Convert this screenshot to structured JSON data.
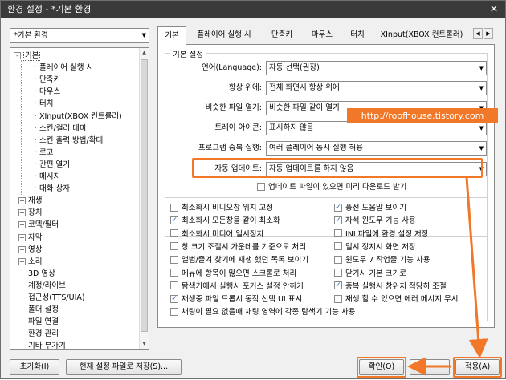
{
  "window": {
    "title": "환경 설정 - *기본 환경",
    "close": "×"
  },
  "profile": {
    "value": "*기본 환경"
  },
  "tree": {
    "root": "기본",
    "children": [
      "플레이어 실행 시",
      "단축키",
      "마우스",
      "터치",
      "XInput(XBOX 컨트롤러)",
      "스킨/컬러 테마",
      "스킨 출력 방법/확대",
      "로고",
      "간편 열기",
      "메시지",
      "대화 상자"
    ],
    "groups": [
      "재생",
      "장치",
      "코덱/필터",
      "자막",
      "영상",
      "소리"
    ],
    "items2": [
      "3D 영상",
      "계정/라이브",
      "접근성(TTS/UIA)",
      "폴더 설정",
      "파일 연결",
      "환경 관리",
      "기타 부가기"
    ]
  },
  "tabs": [
    "기본",
    "플레이어 실행 시",
    "단축키",
    "마우스",
    "터치",
    "XInput(XBOX 컨트롤러)"
  ],
  "basic_settings": {
    "group_title": "기본 설정",
    "rows": [
      {
        "label": "언어(Language):",
        "value": "자동 선택(권장)"
      },
      {
        "label": "항상 위에:",
        "value": "전체 화면시 항상 위에"
      },
      {
        "label": "비슷한 파일 열기:",
        "value": "비슷한 파일 같이 열기"
      },
      {
        "label": "트레이 아이콘:",
        "value": "표시하지 않음"
      },
      {
        "label": "프로그램 중복 실행:",
        "value": "여러 플레이어 동시 실행 허용"
      },
      {
        "label": "자동 업데이트:",
        "value": "자동 업데이트를 하지 않음"
      }
    ],
    "update_check": "업데이트 파일이 있으면 미리 다운로드 받기"
  },
  "checks_left": [
    {
      "label": "최소화시 비디오창 위치 고정",
      "checked": false
    },
    {
      "label": "최소화시 모든창을 같이 최소화",
      "checked": true
    },
    {
      "label": "최소화시 미디어 일시정지",
      "checked": false
    },
    {
      "label": "창 크기 조절시 가운데를 기준으로 처리",
      "checked": false
    },
    {
      "label": "앨범/즐겨 찾기에 재생 했던 목록 보이기",
      "checked": false
    },
    {
      "label": "메뉴에 항목이 많으면 스크롤로 처리",
      "checked": false
    },
    {
      "label": "탐색기에서 실행시 포커스 설정 안하기",
      "checked": false
    },
    {
      "label": "재생중 파일 드롭시 동작 선택 UI 표시",
      "checked": true
    },
    {
      "label": "채팅이 필요 없을때 채팅 영역에 각종 탐색기 기능 사용",
      "checked": false
    }
  ],
  "checks_right": [
    {
      "label": "풍선 도움말 보이기",
      "checked": true
    },
    {
      "label": "자석 윈도우 기능 사용",
      "checked": true
    },
    {
      "label": "INI 파일에 환경 설정 저장",
      "checked": false
    },
    {
      "label": "일시 정지시 화면 저장",
      "checked": false
    },
    {
      "label": "윈도우 7 작업줄 기능 사용",
      "checked": false
    },
    {
      "label": "닫기시 기본 크기로",
      "checked": false
    },
    {
      "label": "중복 실행시 창위치 적당히 조절",
      "checked": true
    },
    {
      "label": "재생 할 수 있으면 에러 메시지 무시",
      "checked": false
    }
  ],
  "buttons": {
    "reset": "초기화(I)",
    "save_current": "현재 설정 파일로 저장(S)...",
    "ok": "확인(O)",
    "apply": "적용(A)"
  },
  "watermark": "http://roofhouse.tistory.com",
  "colors": {
    "highlight": "#f07828",
    "titlebar": "#3a3a3a",
    "check": "#2a5db0"
  }
}
